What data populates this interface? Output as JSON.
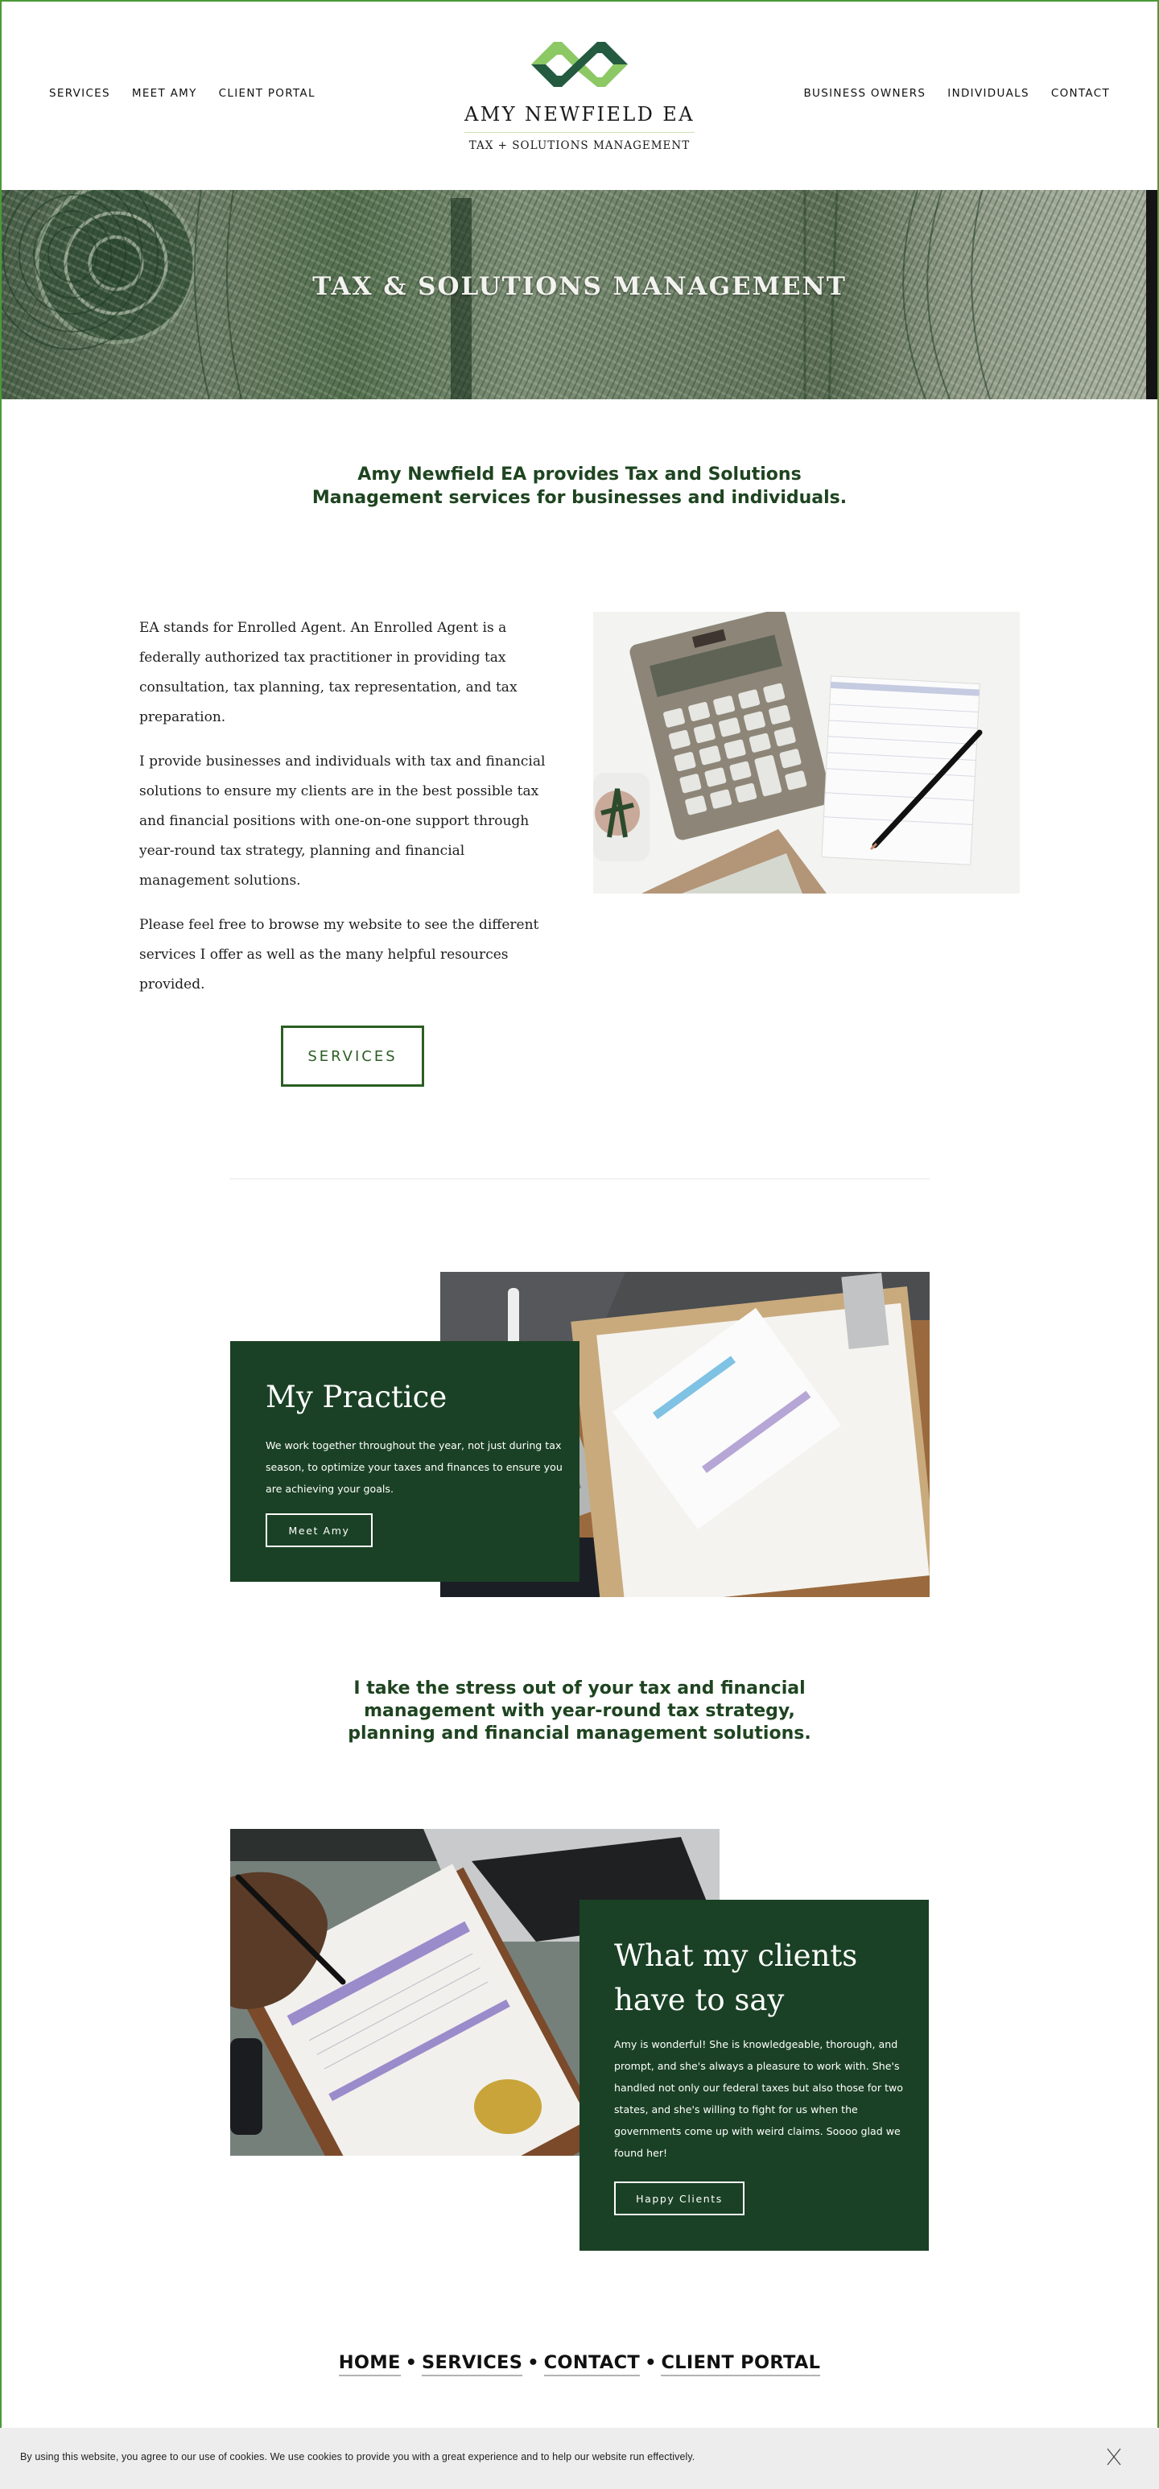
{
  "brand": {
    "name": "AMY NEWFIELD  EA",
    "tagline": "TAX + SOLUTIONS MANAGEMENT",
    "colors": {
      "dark_green": "#1a4125",
      "accent_green": "#2b5e23",
      "logo_dark": "#235a40",
      "logo_light": "#8cc864",
      "page_border": "#4a9a36"
    }
  },
  "nav": {
    "left": [
      {
        "label": "SERVICES",
        "icon": null
      },
      {
        "label": "MEET AMY",
        "icon": null
      },
      {
        "label": "CLIENT PORTAL",
        "icon": null
      }
    ],
    "right": [
      {
        "label": "BUSINESS OWNERS",
        "icon": null
      },
      {
        "label": "INDIVIDUALS",
        "icon": null
      },
      {
        "label": "CONTACT",
        "icon": null
      }
    ]
  },
  "hero": {
    "title": "TAX & SOLUTIONS MANAGEMENT",
    "image": "dollar-bill-closeup"
  },
  "intro": {
    "headline": "Amy Newfield EA provides Tax and Solutions Management services for businesses and individuals.",
    "paragraphs": [
      "EA stands for Enrolled Agent. An Enrolled Agent is a federally authorized tax practitioner in providing tax consultation, tax planning, tax representation, and tax preparation.",
      "I provide businesses and individuals with tax and financial solutions to ensure my clients are in the best possible tax and financial positions with one-on-one support through year-round tax strategy, planning and financial management solutions.",
      "Please feel free to browse my website to see the different services I offer as well as the many helpful resources provided."
    ],
    "button_label": "SERVICES",
    "image": "calculator-and-ledger"
  },
  "practice": {
    "title": "My Practice",
    "body": "We work together throughout the year, not just during tax season, to optimize your taxes and finances to ensure you are achieving your goals.",
    "button_label": "Meet Amy",
    "image": "invoices-on-clipboard"
  },
  "stress": {
    "headline": "I take the stress out of your tax and financial management with year-round tax strategy, planning and financial management solutions."
  },
  "clients": {
    "title": "What my clients have to say",
    "testimonial": "Amy is wonderful! She is knowledgeable, thorough, and prompt, and she's always a pleasure to work with. She's handled not only our federal taxes but also those for two states, and she's willing to fight for us when the governments come up with weird claims. Soooo glad we found her!",
    "button_label": "Happy Clients",
    "image": "hand-writing-on-invoice"
  },
  "footer": {
    "links": [
      "HOME",
      "SERVICES",
      "CONTACT",
      "CLIENT PORTAL"
    ],
    "separator": "•"
  },
  "cookie": {
    "text": "By using this website, you agree to our use of cookies. We use cookies to provide you with a great experience and to help our website run effectively.",
    "close_icon": "close-icon"
  }
}
